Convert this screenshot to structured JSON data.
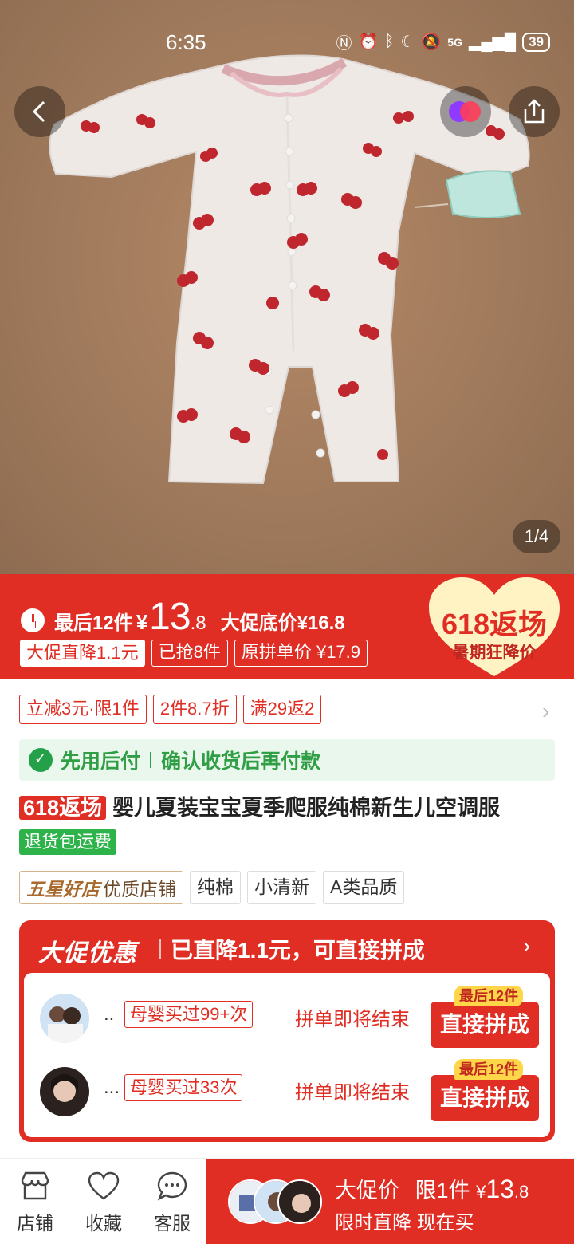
{
  "status_bar": {
    "time": "6:35",
    "network": "5G",
    "battery": "39"
  },
  "gallery": {
    "counter": "1/4"
  },
  "price_band": {
    "stock_text": "最后12件",
    "currency": "¥",
    "price_int": "13",
    "price_dec": ".8",
    "promo_floor": "大促底价¥16.8",
    "tags": [
      "大促直降1.1元",
      "已抢8件",
      "原拼单价 ¥17.9"
    ],
    "badge_title": "618返场",
    "badge_sub": "暑期狂降价"
  },
  "coupons": [
    "立减3元·限1件",
    "2件8.7折",
    "满29返2"
  ],
  "pay_later": {
    "label": "先用后付",
    "desc": "确认收货后再付款"
  },
  "product": {
    "title_badge": "618返场",
    "title": "婴儿夏装宝宝夏季爬服纯棉新生儿空调服",
    "refund_badge": "退货包运费",
    "store_badge": "五星好店",
    "store_quality": "优质店铺",
    "features": [
      "纯棉",
      "小清新",
      "A类品质"
    ]
  },
  "promo_card": {
    "logo": "大促优惠",
    "headline": "已直降1.1元，可直接拼成",
    "groups": [
      {
        "dots": "..",
        "bought": "母婴买过99+次",
        "status": "拼单即将结束",
        "tag": "最后12件",
        "button": "直接拼成"
      },
      {
        "dots": "...",
        "bought": "母婴买过33次",
        "status": "拼单即将结束",
        "tag": "最后12件",
        "button": "直接拼成"
      }
    ]
  },
  "bottom_bar": {
    "store": "店铺",
    "favorite": "收藏",
    "service": "客服",
    "buy_label": "大促价",
    "buy_limit": "限1件",
    "buy_currency": "¥",
    "buy_price_int": "13",
    "buy_price_dec": ".8",
    "buy_sub": "限时直降 现在买"
  },
  "colors": {
    "brand_red": "#e02e24",
    "green": "#2eb34a",
    "gold": "#ffd54a"
  }
}
